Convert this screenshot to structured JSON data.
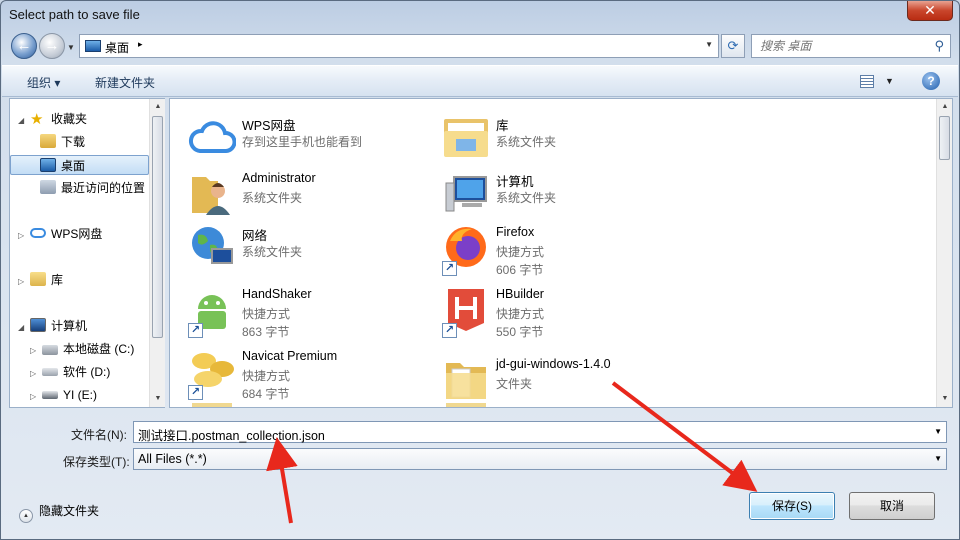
{
  "window": {
    "title": "Select path to save file",
    "close_label": "✕"
  },
  "navbar": {
    "back_label": "←",
    "forward_label": "→",
    "address": "桌面",
    "address_separator": "▸",
    "search_placeholder": "搜索 桌面"
  },
  "toolbar": {
    "organize_label": "组织 ▾",
    "new_folder_label": "新建文件夹",
    "help_label": "?"
  },
  "sidebar": {
    "items": [
      {
        "label": "收藏夹"
      },
      {
        "label": "下载"
      },
      {
        "label": "桌面"
      },
      {
        "label": "最近访问的位置"
      },
      {
        "label": "WPS网盘"
      },
      {
        "label": "库"
      },
      {
        "label": "计算机"
      },
      {
        "label": "本地磁盘 (C:)"
      },
      {
        "label": "软件 (D:)"
      },
      {
        "label": "YI (E:)"
      }
    ]
  },
  "files": [
    {
      "name": "WPS网盘",
      "line2": "存到这里手机也能看到",
      "line3": ""
    },
    {
      "name": "库",
      "line2": "系统文件夹",
      "line3": ""
    },
    {
      "name": "Administrator",
      "line2": "系统文件夹",
      "line3": ""
    },
    {
      "name": "计算机",
      "line2": "系统文件夹",
      "line3": ""
    },
    {
      "name": "网络",
      "line2": "系统文件夹",
      "line3": ""
    },
    {
      "name": "Firefox",
      "line2": "快捷方式",
      "line3": "606 字节"
    },
    {
      "name": "HandShaker",
      "line2": "快捷方式",
      "line3": "863 字节"
    },
    {
      "name": "HBuilder",
      "line2": "快捷方式",
      "line3": "550 字节"
    },
    {
      "name": "Navicat Premium",
      "line2": "快捷方式",
      "line3": "684 字节"
    },
    {
      "name": "jd-gui-windows-1.4.0",
      "line2": "文件夹",
      "line3": ""
    }
  ],
  "form": {
    "filename_label": "文件名(N):",
    "filename_value": "测试接口.postman_collection.json",
    "filetype_label": "保存类型(T):",
    "filetype_value": "All Files (*.*)"
  },
  "footer": {
    "hide_folders_label": "隐藏文件夹",
    "save_label": "保存(S)",
    "cancel_label": "取消"
  },
  "colors": {
    "accent": "#3c7fb1",
    "annotation_arrow": "#e8281c",
    "close": "#c9462c"
  }
}
